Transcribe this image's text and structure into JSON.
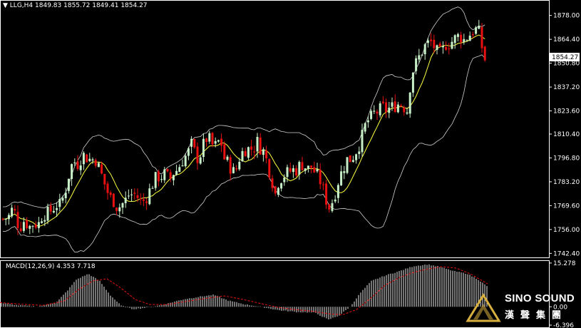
{
  "chart_data": {
    "type": "candlestick",
    "symbol": "LLG,H4",
    "header_values": [
      "1849.83",
      "1855.72",
      "1849.41",
      "1854.27"
    ],
    "price_axis": {
      "ylim": [
        1740.5,
        1886
      ],
      "ticks": [
        "1878.00",
        "1864.40",
        "1850.80",
        "1837.20",
        "1823.60",
        "1810.40",
        "1796.80",
        "1783.20",
        "1769.60",
        "1756.00",
        "1742.40"
      ],
      "current_price": "1854.27"
    },
    "macd_axis": {
      "ylim": [
        -6.9,
        15.5
      ],
      "ticks": [
        "15.278",
        "0.00",
        "-6.396"
      ]
    },
    "macd_label": "MACD(12,26,9) 4.353 7.718",
    "path_points": [
      [
        0,
        1762
      ],
      [
        6,
        1762
      ],
      [
        14,
        1764
      ],
      [
        19,
        1770
      ],
      [
        23,
        1760
      ],
      [
        29,
        1758
      ],
      [
        35,
        1762
      ],
      [
        40,
        1757
      ],
      [
        48,
        1760
      ],
      [
        53,
        1758
      ],
      [
        60,
        1765
      ],
      [
        66,
        1765
      ],
      [
        72,
        1767
      ],
      [
        79,
        1770
      ],
      [
        85,
        1770
      ],
      [
        90,
        1776
      ],
      [
        94,
        1782
      ],
      [
        98,
        1790
      ],
      [
        103,
        1795
      ],
      [
        107,
        1794
      ],
      [
        111,
        1793
      ],
      [
        115,
        1799
      ],
      [
        119,
        1798
      ],
      [
        124,
        1796
      ],
      [
        129,
        1796
      ],
      [
        134,
        1796
      ],
      [
        140,
        1790
      ],
      [
        145,
        1784
      ],
      [
        150,
        1778
      ],
      [
        155,
        1774
      ],
      [
        160,
        1772
      ],
      [
        165,
        1768
      ],
      [
        170,
        1770
      ],
      [
        175,
        1772
      ],
      [
        181,
        1776
      ],
      [
        186,
        1776
      ],
      [
        191,
        1776
      ],
      [
        196,
        1772
      ],
      [
        201,
        1772
      ],
      [
        206,
        1775
      ],
      [
        212,
        1780
      ],
      [
        216,
        1784
      ],
      [
        220,
        1786
      ],
      [
        226,
        1786
      ],
      [
        230,
        1788
      ],
      [
        235,
        1786
      ],
      [
        240,
        1785
      ],
      [
        244,
        1789
      ],
      [
        249,
        1790
      ],
      [
        255,
        1795
      ],
      [
        259,
        1797
      ],
      [
        264,
        1800
      ],
      [
        270,
        1806
      ],
      [
        274,
        1798
      ],
      [
        279,
        1796
      ],
      [
        285,
        1804
      ],
      [
        290,
        1808
      ],
      [
        295,
        1807
      ],
      [
        300,
        1802
      ],
      [
        305,
        1806
      ],
      [
        310,
        1806
      ],
      [
        315,
        1796
      ],
      [
        320,
        1794
      ],
      [
        325,
        1790
      ],
      [
        330,
        1788
      ],
      [
        335,
        1796
      ],
      [
        340,
        1800
      ],
      [
        345,
        1802
      ],
      [
        350,
        1802
      ],
      [
        356,
        1802
      ],
      [
        361,
        1806
      ],
      [
        366,
        1802
      ],
      [
        371,
        1800
      ],
      [
        376,
        1792
      ],
      [
        381,
        1785
      ],
      [
        386,
        1776
      ],
      [
        391,
        1784
      ],
      [
        396,
        1786
      ],
      [
        401,
        1788
      ],
      [
        406,
        1789
      ],
      [
        411,
        1790
      ],
      [
        416,
        1790
      ],
      [
        421,
        1793
      ],
      [
        426,
        1793
      ],
      [
        431,
        1790
      ],
      [
        436,
        1792
      ],
      [
        441,
        1789
      ],
      [
        446,
        1786
      ],
      [
        451,
        1782
      ],
      [
        456,
        1775
      ],
      [
        461,
        1768
      ],
      [
        466,
        1772
      ],
      [
        471,
        1778
      ],
      [
        476,
        1786
      ],
      [
        481,
        1790
      ],
      [
        486,
        1796
      ],
      [
        491,
        1796
      ],
      [
        496,
        1798
      ],
      [
        501,
        1802
      ],
      [
        506,
        1806
      ],
      [
        511,
        1814
      ],
      [
        516,
        1818
      ],
      [
        521,
        1820
      ],
      [
        526,
        1823
      ],
      [
        531,
        1823
      ],
      [
        536,
        1826
      ],
      [
        541,
        1824
      ],
      [
        546,
        1825
      ],
      [
        551,
        1826
      ],
      [
        556,
        1827
      ],
      [
        561,
        1828
      ],
      [
        566,
        1826
      ],
      [
        571,
        1824
      ],
      [
        576,
        1840
      ],
      [
        580,
        1848
      ],
      [
        585,
        1852
      ],
      [
        590,
        1856
      ],
      [
        595,
        1860
      ],
      [
        600,
        1862
      ],
      [
        606,
        1863
      ],
      [
        611,
        1858
      ],
      [
        616,
        1856
      ],
      [
        621,
        1858
      ],
      [
        626,
        1862
      ],
      [
        631,
        1862
      ],
      [
        636,
        1864
      ],
      [
        641,
        1866
      ],
      [
        646,
        1866
      ],
      [
        651,
        1864
      ],
      [
        656,
        1866
      ],
      [
        661,
        1868
      ],
      [
        666,
        1870
      ],
      [
        671,
        1870
      ],
      [
        676,
        1860
      ],
      [
        680,
        1853
      ],
      [
        684,
        1852
      ]
    ],
    "macd_path_points": [
      [
        0,
        1.4
      ],
      [
        23,
        0.6
      ],
      [
        53,
        0.1
      ],
      [
        79,
        1.5
      ],
      [
        94,
        5.5
      ],
      [
        107,
        9.5
      ],
      [
        124,
        11.5
      ],
      [
        140,
        9.0
      ],
      [
        155,
        4.0
      ],
      [
        170,
        0.4
      ],
      [
        186,
        -0.8
      ],
      [
        206,
        -0.3
      ],
      [
        230,
        0.8
      ],
      [
        255,
        2.5
      ],
      [
        279,
        3.5
      ],
      [
        300,
        4.2
      ],
      [
        320,
        2.2
      ],
      [
        345,
        0.8
      ],
      [
        366,
        0.0
      ],
      [
        391,
        -1.2
      ],
      [
        416,
        -1.8
      ],
      [
        441,
        -2.0
      ],
      [
        461,
        -4.5
      ],
      [
        476,
        -3.0
      ],
      [
        491,
        0.0
      ],
      [
        506,
        5.0
      ],
      [
        521,
        9.0
      ],
      [
        541,
        11.0
      ],
      [
        561,
        12.5
      ],
      [
        580,
        14.2
      ],
      [
        600,
        14.8
      ],
      [
        616,
        14.0
      ],
      [
        636,
        12.5
      ],
      [
        656,
        11.5
      ],
      [
        671,
        9.5
      ],
      [
        684,
        7.0
      ]
    ],
    "signal_path_points": [
      [
        0,
        1.5
      ],
      [
        30,
        0.9
      ],
      [
        60,
        0.5
      ],
      [
        90,
        2.0
      ],
      [
        110,
        6.0
      ],
      [
        130,
        9.0
      ],
      [
        150,
        9.8
      ],
      [
        170,
        6.5
      ],
      [
        190,
        2.5
      ],
      [
        210,
        0.8
      ],
      [
        235,
        0.8
      ],
      [
        260,
        1.8
      ],
      [
        290,
        3.0
      ],
      [
        315,
        3.8
      ],
      [
        340,
        2.6
      ],
      [
        365,
        1.2
      ],
      [
        390,
        -0.2
      ],
      [
        415,
        -1.0
      ],
      [
        440,
        -1.6
      ],
      [
        460,
        -2.4
      ],
      [
        480,
        -2.8
      ],
      [
        500,
        -1.0
      ],
      [
        520,
        3.0
      ],
      [
        540,
        7.5
      ],
      [
        560,
        10.2
      ],
      [
        580,
        12.0
      ],
      [
        600,
        13.2
      ],
      [
        620,
        14.0
      ],
      [
        640,
        13.5
      ],
      [
        660,
        11.5
      ],
      [
        684,
        8.0
      ]
    ],
    "colors": {
      "background": "#000000",
      "bull": "#c8f0c8",
      "bear": "#e81010",
      "bands": "#d0d0d0",
      "moving_average": "#ffff40",
      "macd_histogram": "#e8e8e8",
      "signal": "#e81010",
      "axis_text": "#ffffff",
      "logo_gold": "#d8b040"
    },
    "logo": {
      "text_en": "SINO SOUND",
      "text_cn": "漢聲集團"
    }
  }
}
